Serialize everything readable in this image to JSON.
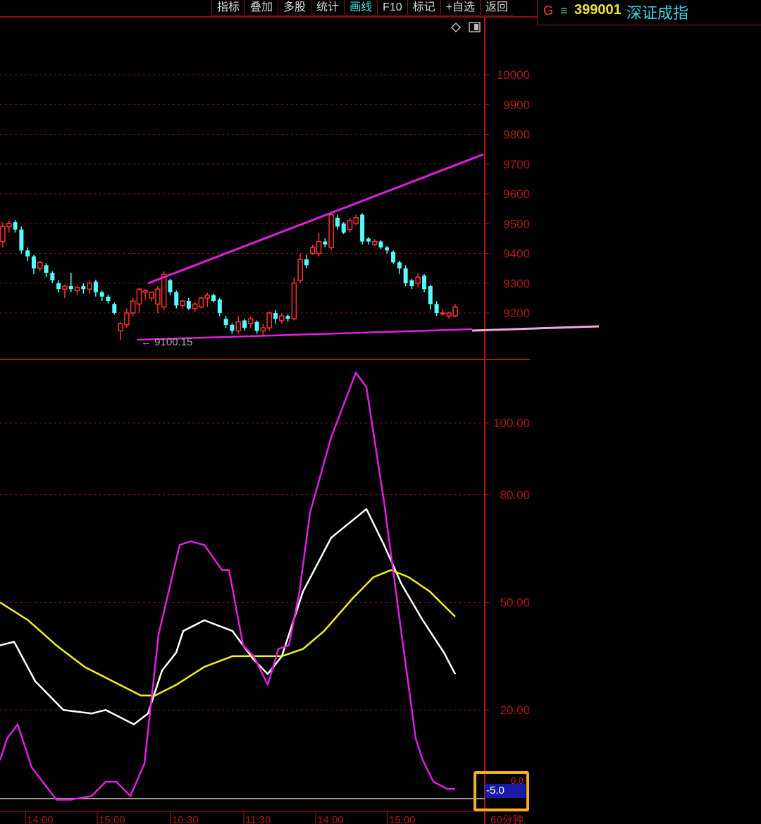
{
  "toolbar": {
    "items": [
      {
        "label": "指标",
        "active": false
      },
      {
        "label": "叠加",
        "active": false
      },
      {
        "label": "多股",
        "active": false
      },
      {
        "label": "统计",
        "active": false
      },
      {
        "label": "画线",
        "active": true
      },
      {
        "label": "F10",
        "active": false
      },
      {
        "label": "标记",
        "active": false
      },
      {
        "label": "+自选",
        "active": false
      },
      {
        "label": "返回",
        "active": false
      }
    ]
  },
  "symbol": {
    "prefix": "G",
    "menu_glyph": "≡",
    "code": "399001",
    "name": "深证成指"
  },
  "colors": {
    "up": "#ff3030",
    "down": "#54ffff",
    "grid": "#7a1b1b",
    "axis": "#b01818",
    "trendline": "#e020e0",
    "k_line": "#ffffff",
    "d_line": "#f0f020",
    "j_line": "#e020e0",
    "value_box_border": "#f0b020",
    "value_box_fill": "#1a1aa8"
  },
  "value_box": {
    "zero_label": "0.0",
    "value": "-5.0"
  },
  "chart_data": [
    {
      "type": "candlestick",
      "ylim": [
        9100,
        10000
      ],
      "y_ticks": [
        "10000",
        "9900",
        "9800",
        "9700",
        "9600",
        "9500",
        "9400",
        "9300",
        "9200"
      ],
      "low_marker": "9100.15",
      "candles": [
        [
          9440,
          9490,
          9420,
          9505
        ],
        [
          9490,
          9500,
          9470,
          9508
        ],
        [
          9505,
          9480,
          9470,
          9512
        ],
        [
          9480,
          9410,
          9400,
          9490
        ],
        [
          9410,
          9390,
          9375,
          9420
        ],
        [
          9390,
          9350,
          9330,
          9395
        ],
        [
          9350,
          9370,
          9340,
          9375
        ],
        [
          9360,
          9335,
          9320,
          9368
        ],
        [
          9335,
          9310,
          9300,
          9340
        ],
        [
          9300,
          9280,
          9268,
          9310
        ],
        [
          9280,
          9290,
          9250,
          9295
        ],
        [
          9290,
          9280,
          9270,
          9335
        ],
        [
          9275,
          9285,
          9260,
          9292
        ],
        [
          9290,
          9280,
          9265,
          9300
        ],
        [
          9280,
          9300,
          9265,
          9310
        ],
        [
          9305,
          9270,
          9255,
          9312
        ],
        [
          9270,
          9255,
          9240,
          9275
        ],
        [
          9255,
          9240,
          9232,
          9262
        ],
        [
          9230,
          9200,
          9195,
          9235
        ],
        [
          9140,
          9165,
          9110,
          9170
        ],
        [
          9160,
          9200,
          9150,
          9215
        ],
        [
          9200,
          9240,
          9190,
          9250
        ],
        [
          9230,
          9280,
          9200,
          9285
        ],
        [
          9270,
          9275,
          9245,
          9280
        ],
        [
          9250,
          9270,
          9240,
          9272
        ],
        [
          9230,
          9280,
          9200,
          9290
        ],
        [
          9220,
          9330,
          9210,
          9340
        ],
        [
          9310,
          9270,
          9260,
          9315
        ],
        [
          9270,
          9225,
          9215,
          9275
        ],
        [
          9225,
          9240,
          9215,
          9245
        ],
        [
          9240,
          9215,
          9210,
          9250
        ],
        [
          9215,
          9230,
          9205,
          9238
        ],
        [
          9220,
          9250,
          9215,
          9255
        ],
        [
          9250,
          9260,
          9220,
          9268
        ],
        [
          9260,
          9240,
          9235,
          9265
        ],
        [
          9245,
          9200,
          9190,
          9250
        ],
        [
          9180,
          9160,
          9150,
          9190
        ],
        [
          9160,
          9140,
          9130,
          9165
        ],
        [
          9140,
          9170,
          9130,
          9190
        ],
        [
          9175,
          9150,
          9140,
          9180
        ],
        [
          9165,
          9180,
          9150,
          9188
        ],
        [
          9170,
          9140,
          9130,
          9175
        ],
        [
          9140,
          9150,
          9120,
          9165
        ],
        [
          9150,
          9200,
          9140,
          9205
        ],
        [
          9200,
          9180,
          9165,
          9210
        ],
        [
          9175,
          9190,
          9165,
          9198
        ],
        [
          9190,
          9180,
          9170,
          9195
        ],
        [
          9180,
          9300,
          9175,
          9320
        ],
        [
          9310,
          9380,
          9300,
          9400
        ],
        [
          9380,
          9360,
          9350,
          9395
        ],
        [
          9400,
          9420,
          9395,
          9430
        ],
        [
          9400,
          9440,
          9390,
          9470
        ],
        [
          9440,
          9430,
          9420,
          9450
        ],
        [
          9420,
          9530,
          9410,
          9540
        ],
        [
          9520,
          9490,
          9480,
          9530
        ],
        [
          9500,
          9470,
          9465,
          9505
        ],
        [
          9480,
          9510,
          9470,
          9520
        ],
        [
          9500,
          9520,
          9495,
          9530
        ],
        [
          9530,
          9440,
          9430,
          9535
        ],
        [
          9450,
          9440,
          9430,
          9455
        ],
        [
          9430,
          9440,
          9425,
          9448
        ],
        [
          9440,
          9420,
          9415,
          9445
        ],
        [
          9420,
          9410,
          9400,
          9425
        ],
        [
          9405,
          9370,
          9365,
          9410
        ],
        [
          9370,
          9350,
          9330,
          9375
        ],
        [
          9350,
          9300,
          9290,
          9360
        ],
        [
          9310,
          9290,
          9280,
          9315
        ],
        [
          9300,
          9320,
          9285,
          9335
        ],
        [
          9325,
          9280,
          9270,
          9330
        ],
        [
          9290,
          9230,
          9210,
          9295
        ],
        [
          9230,
          9200,
          9190,
          9240
        ],
        [
          9200,
          9200,
          9190,
          9215
        ],
        [
          9190,
          9200,
          9180,
          9205
        ],
        [
          9190,
          9220,
          9185,
          9230
        ]
      ]
    },
    {
      "type": "line",
      "ylim": [
        -10,
        120
      ],
      "y_ticks": [
        "100.00",
        "80.00",
        "50.00",
        "20.00",
        "0.0"
      ],
      "x_ticks": [
        "14:00",
        "15:00",
        "10:30",
        "11:30",
        "14:00",
        "15:00",
        "60分钟"
      ],
      "series": [
        {
          "name": "K",
          "color": "#ffffff",
          "values": [
            [
              0,
              38
            ],
            [
              20,
              39
            ],
            [
              50,
              28
            ],
            [
              90,
              20
            ],
            [
              130,
              19
            ],
            [
              150,
              20
            ],
            [
              190,
              16
            ],
            [
              210,
              19
            ],
            [
              230,
              31
            ],
            [
              250,
              36
            ],
            [
              260,
              42
            ],
            [
              290,
              45
            ],
            [
              330,
              42
            ],
            [
              360,
              34
            ],
            [
              380,
              30
            ],
            [
              400,
              35
            ],
            [
              430,
              53
            ],
            [
              470,
              68
            ],
            [
              520,
              76
            ],
            [
              545,
              66
            ],
            [
              570,
              55
            ],
            [
              600,
              45
            ],
            [
              630,
              36
            ],
            [
              646,
              30
            ]
          ]
        },
        {
          "name": "D",
          "color": "#f0f020",
          "values": [
            [
              0,
              50
            ],
            [
              40,
              45
            ],
            [
              80,
              38
            ],
            [
              120,
              32
            ],
            [
              160,
              28
            ],
            [
              200,
              24
            ],
            [
              220,
              24
            ],
            [
              250,
              27
            ],
            [
              290,
              32
            ],
            [
              330,
              35
            ],
            [
              370,
              35
            ],
            [
              400,
              35
            ],
            [
              430,
              37
            ],
            [
              460,
              42
            ],
            [
              500,
              51
            ],
            [
              530,
              57
            ],
            [
              555,
              59
            ],
            [
              580,
              57
            ],
            [
              610,
              53
            ],
            [
              646,
              46
            ]
          ]
        },
        {
          "name": "J",
          "color": "#e020e0",
          "values": [
            [
              0,
              6
            ],
            [
              10,
              12
            ],
            [
              25,
              16
            ],
            [
              45,
              4
            ],
            [
              80,
              -5
            ],
            [
              100,
              -5
            ],
            [
              130,
              -4
            ],
            [
              150,
              0
            ],
            [
              165,
              0
            ],
            [
              185,
              -4
            ],
            [
              205,
              5
            ],
            [
              225,
              41
            ],
            [
              255,
              66
            ],
            [
              270,
              67
            ],
            [
              290,
              66
            ],
            [
              315,
              59
            ],
            [
              325,
              59
            ],
            [
              345,
              38
            ],
            [
              360,
              35
            ],
            [
              380,
              27
            ],
            [
              395,
              37
            ],
            [
              410,
              38
            ],
            [
              425,
              53
            ],
            [
              440,
              75
            ],
            [
              470,
              96
            ],
            [
              505,
              114
            ],
            [
              520,
              110
            ],
            [
              545,
              78
            ],
            [
              570,
              41
            ],
            [
              590,
              12
            ],
            [
              600,
              6
            ],
            [
              615,
              0
            ],
            [
              635,
              -2
            ],
            [
              646,
              -2
            ]
          ]
        }
      ]
    }
  ]
}
